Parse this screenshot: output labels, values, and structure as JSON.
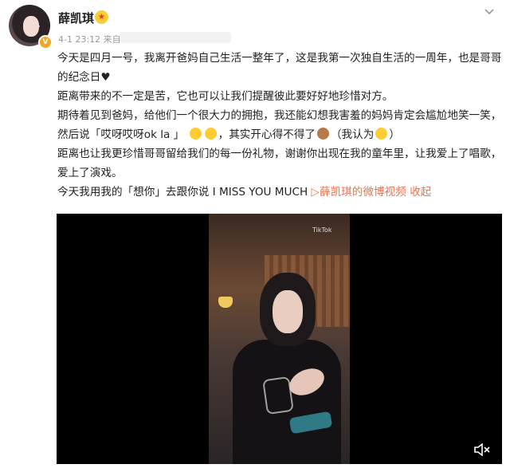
{
  "post": {
    "username": "薛凯琪",
    "timestamp": "4-1 23:12",
    "source_prefix": "来自",
    "lines": [
      "今天是四月一号，我离开爸妈自己生活一整年了，这是我第一次独自生活的一周年，也是哥哥的纪念日♥",
      "距离带来的不一定是苦，它也可以让我们提醒彼此要好好地珍惜对方。",
      "期待着见到爸妈，给他们一个很大力的拥抱，我还能幻想我害羞的妈妈肯定会尴尬地笑一笑，然后说「哎呀哎呀ok la 」",
      "，其实开心得不得了",
      "（我认为",
      "）",
      "距离也让我更珍惜哥哥留给我们的每一份礼物，谢谢你出现在我的童年里，让我爱上了唱歌，爱上了演戏。",
      "今天我用我的「想你」去跟你说 I MISS YOU MUCH "
    ],
    "video_link": "薛凯琪的微博视频",
    "collapse_label": "收起"
  },
  "video": {
    "watermark": "TikTok"
  },
  "colors": {
    "link": "#eb7350",
    "badge": "#f5a623"
  },
  "icons": [
    "chevron-down-icon",
    "verified-badge-icon",
    "volume-icon",
    "play-link-icon"
  ]
}
